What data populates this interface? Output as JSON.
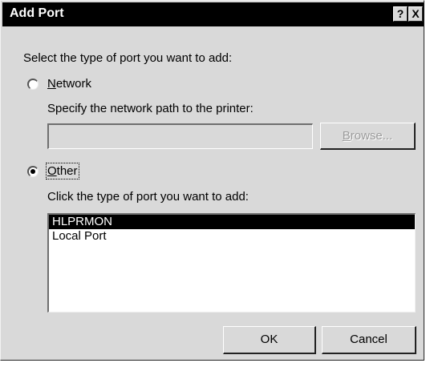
{
  "dialog": {
    "title": "Add Port",
    "help_button": "?",
    "close_button": "X"
  },
  "prompt": "Select the type of port you want to add:",
  "network": {
    "label_underlined": "N",
    "label_rest": "etwork",
    "selected": false,
    "path_label": "Specify the network path to the printer:",
    "path_value": "",
    "browse_underlined": "B",
    "browse_rest": "rowse..."
  },
  "other": {
    "label_underlined": "O",
    "label_rest": "ther",
    "selected": true,
    "list_label": "Click the type of port you want to add:",
    "ports": [
      {
        "label": "HLPRMON",
        "selected": true
      },
      {
        "label": "Local Port",
        "selected": false
      }
    ]
  },
  "buttons": {
    "ok": "OK",
    "cancel": "Cancel"
  }
}
